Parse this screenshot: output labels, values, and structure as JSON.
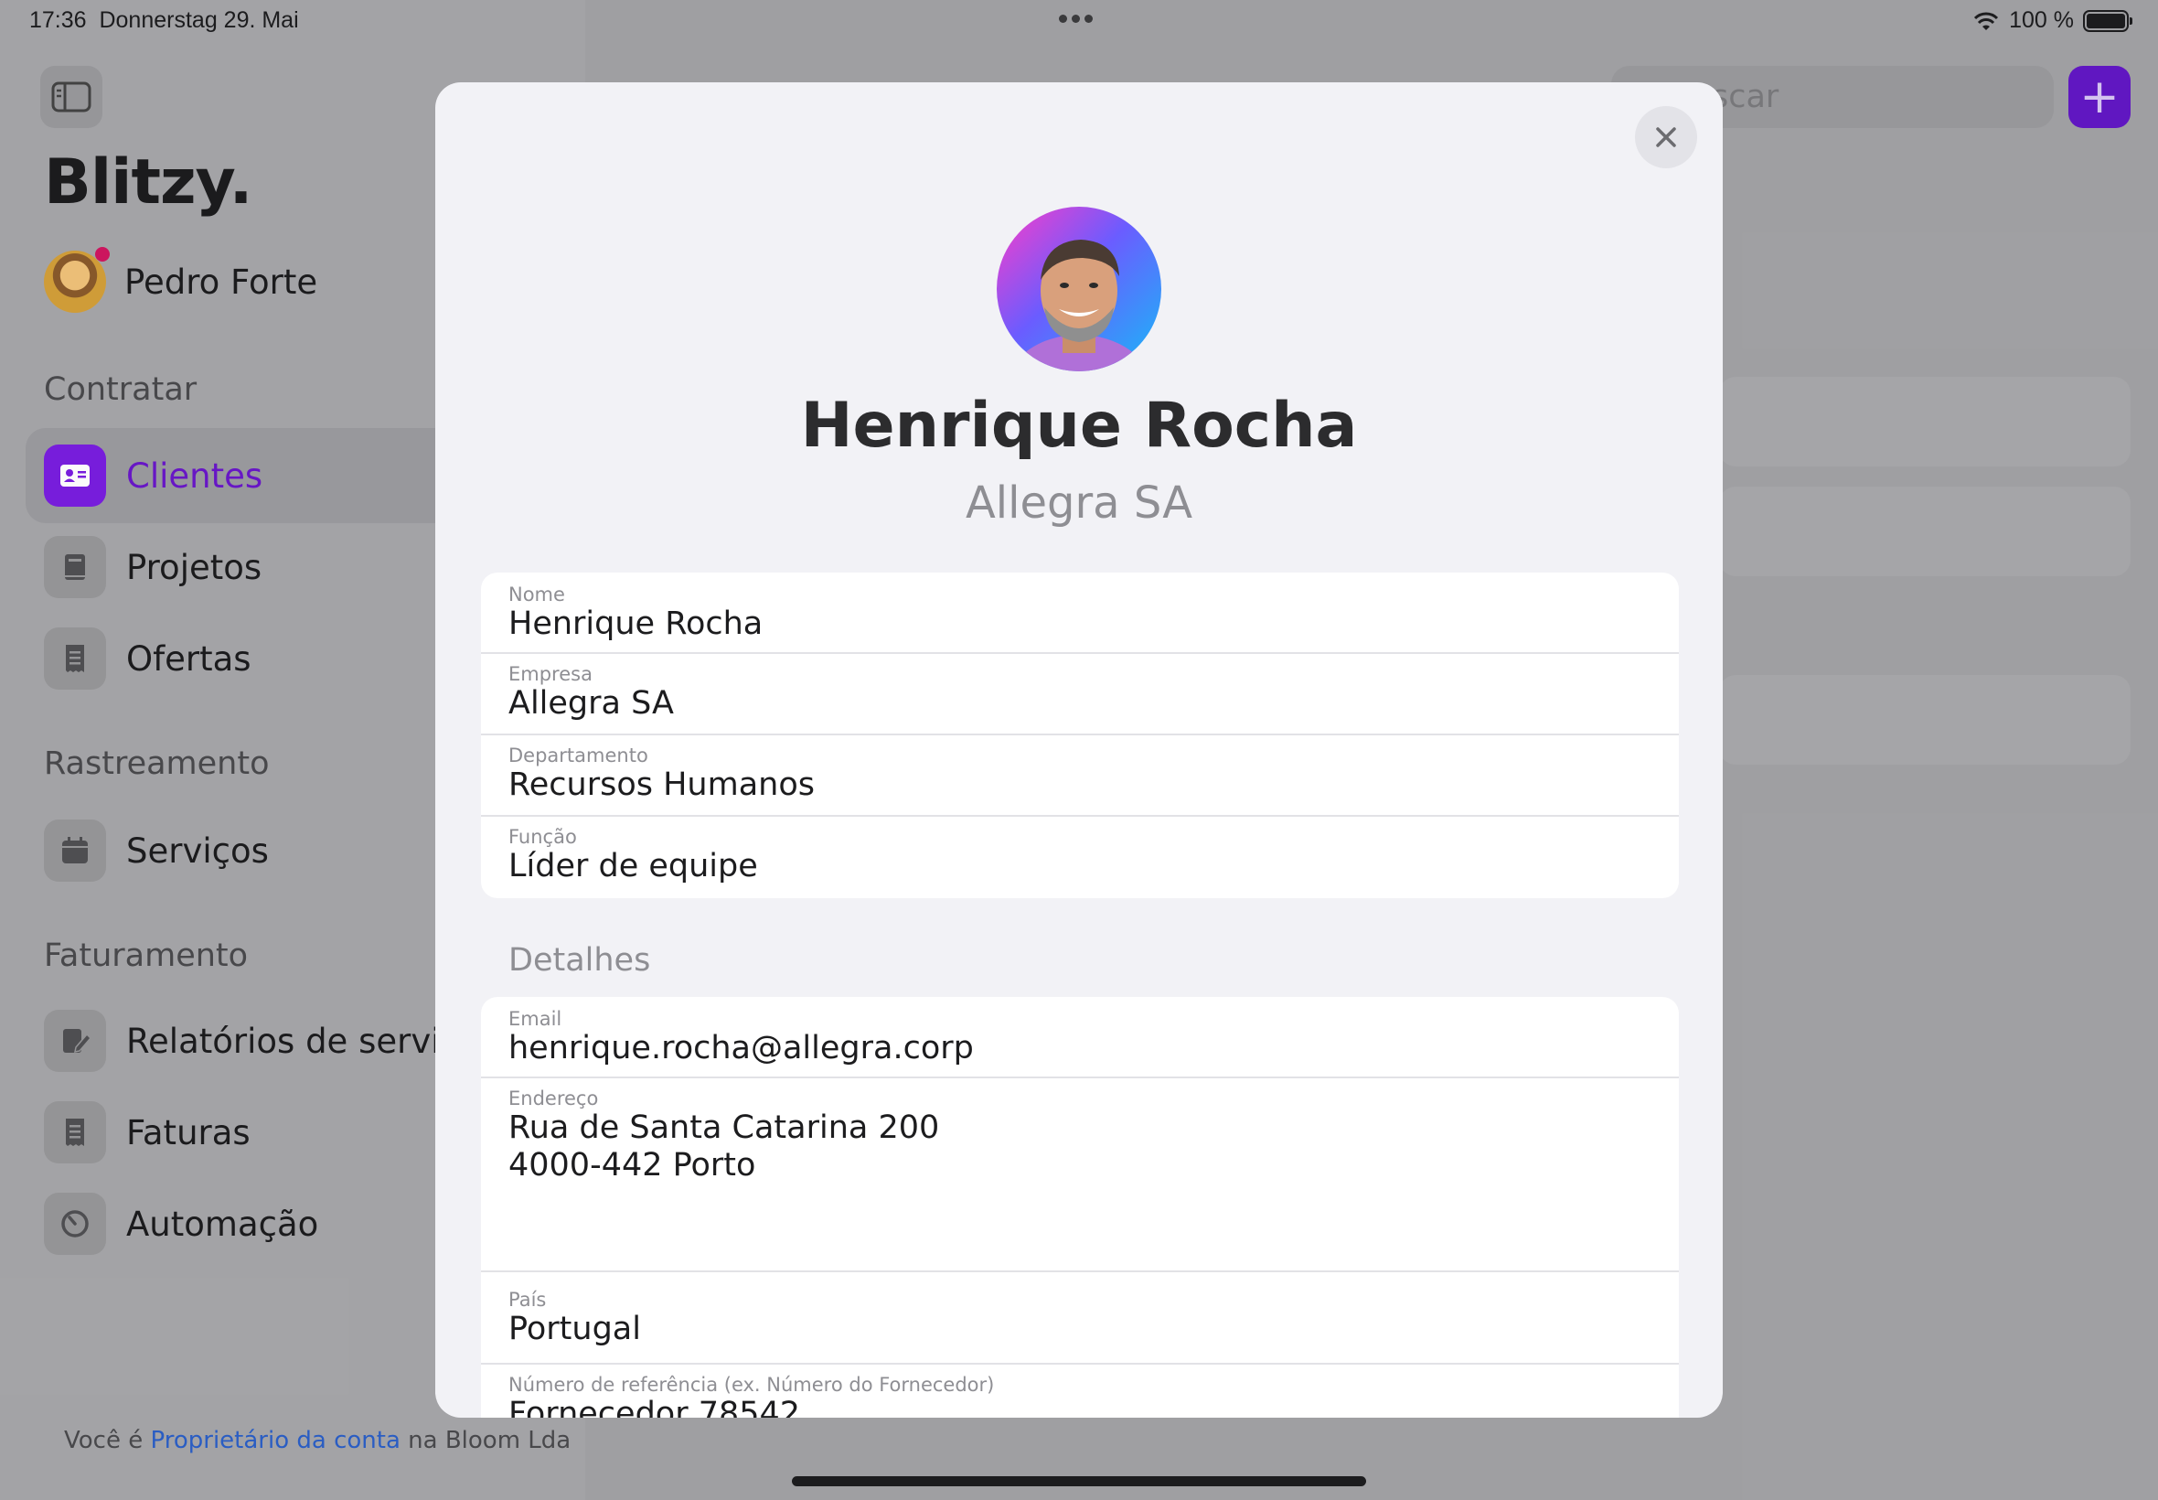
{
  "status_bar": {
    "time": "17:36",
    "date": "Donnerstag 29. Mai",
    "battery": "100 %"
  },
  "sidebar": {
    "brand": "Blitzy.",
    "user_name": "Pedro Forte",
    "sections": [
      {
        "title": "Contratar"
      },
      {
        "title": "Rastreamento"
      },
      {
        "title": "Faturamento"
      }
    ],
    "items": [
      {
        "label": "Clientes",
        "icon": "contact-card-icon",
        "active": true
      },
      {
        "label": "Projetos",
        "icon": "book-icon"
      },
      {
        "label": "Ofertas",
        "icon": "receipt-icon"
      },
      {
        "label": "Serviços",
        "icon": "calendar-icon"
      },
      {
        "label": "Relatórios de serviço",
        "icon": "document-edit-icon"
      },
      {
        "label": "Faturas",
        "icon": "invoice-icon"
      },
      {
        "label": "Automação",
        "icon": "timer-icon"
      }
    ],
    "footer": {
      "prefix": "Você é",
      "link": "Proprietário da conta",
      "suffix": "na Bloom Lda"
    }
  },
  "background": {
    "search_placeholder": "scar",
    "add_label": "+"
  },
  "modal": {
    "name": "Henrique Rocha",
    "company": "Allegra SA",
    "close_icon": "close-icon",
    "fields": [
      {
        "label": "Nome",
        "value": "Henrique Rocha"
      },
      {
        "label": "Empresa",
        "value": "Allegra SA"
      },
      {
        "label": "Departamento",
        "value": "Recursos Humanos"
      },
      {
        "label": "Função",
        "value": "Líder de equipe"
      }
    ],
    "details_heading": "Detalhes",
    "details": [
      {
        "label": "Email",
        "value": "henrique.rocha@allegra.corp"
      },
      {
        "label": "Endereço",
        "line1": "Rua de Santa Catarina 200",
        "line2": "4000-442 Porto"
      },
      {
        "label": "País",
        "value": "Portugal"
      },
      {
        "label": "Número de referência (ex. Número do Fornecedor)",
        "value": "Fornecedor 78542"
      }
    ]
  },
  "colors": {
    "accent": "#7a1ee0",
    "link": "#2b5fc7"
  }
}
